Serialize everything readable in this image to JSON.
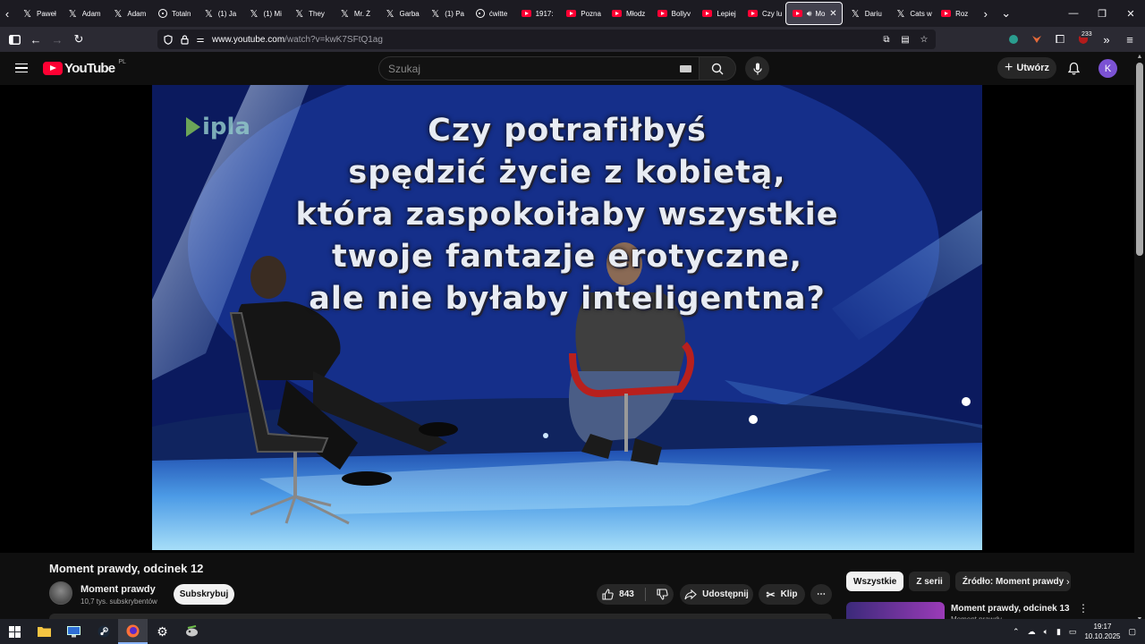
{
  "browser": {
    "tabs": [
      {
        "icon": "x-icon",
        "label": "Paweł"
      },
      {
        "icon": "x-icon",
        "label": "Adam"
      },
      {
        "icon": "x-icon",
        "label": "Adam"
      },
      {
        "icon": "ring-icon",
        "label": "Totaln"
      },
      {
        "icon": "x-icon",
        "label": "(1) Ja"
      },
      {
        "icon": "x-icon",
        "label": "(1) Mi"
      },
      {
        "icon": "x-icon",
        "label": "They"
      },
      {
        "icon": "x-icon",
        "label": "Mr. Ż"
      },
      {
        "icon": "x-icon",
        "label": "Garba"
      },
      {
        "icon": "x-icon",
        "label": "(1) Pa"
      },
      {
        "icon": "ring-icon",
        "label": "ćwitte"
      },
      {
        "icon": "youtube-icon",
        "label": "1917:"
      },
      {
        "icon": "youtube-icon",
        "label": "Pozna"
      },
      {
        "icon": "youtube-icon",
        "label": "Młodz"
      },
      {
        "icon": "youtube-icon",
        "label": "Bollyv"
      },
      {
        "icon": "youtube-icon",
        "label": "Lepiej"
      },
      {
        "icon": "youtube-icon",
        "label": "Czy lu"
      }
    ],
    "active_tab": {
      "label": "Mo"
    },
    "tabs_after": [
      {
        "icon": "x-icon",
        "label": "Dariu"
      },
      {
        "icon": "x-icon",
        "label": "Cats w"
      },
      {
        "icon": "youtube-icon",
        "label": "Roz"
      }
    ],
    "url_host": "www.youtube.com",
    "url_path": "/watch?v=kwK7SFtQ1ag",
    "extensions_badge": "233"
  },
  "youtube": {
    "logo_text": "YouTube",
    "country_code": "PL",
    "search_placeholder": "Szukaj",
    "create_label": "Utwórz",
    "avatar_letter": "K"
  },
  "video": {
    "watermark": "ipla",
    "caption_lines": [
      "Czy potrafiłbyś",
      "spędzić życie z kobietą,",
      "która zaspokoiłaby wszystkie",
      "twoje fantazje erotyczne,",
      "ale nie byłaby inteligentna?"
    ],
    "title": "Moment prawdy, odcinek 12"
  },
  "channel": {
    "name": "Moment prawdy",
    "subscribers": "10,7 tys. subskrybentów",
    "subscribe_label": "Subskrybuj"
  },
  "actions": {
    "likes": "843",
    "share_label": "Udostępnij",
    "clip_label": "Klip"
  },
  "chips": [
    "Wszystkie",
    "Z serii",
    "Źródło: Moment prawdy"
  ],
  "recommendation": {
    "title": "Moment prawdy, odcinek 13",
    "channel": "Moment prawdy"
  },
  "taskbar": {
    "time": "19:17",
    "date": "10.10.2025"
  }
}
